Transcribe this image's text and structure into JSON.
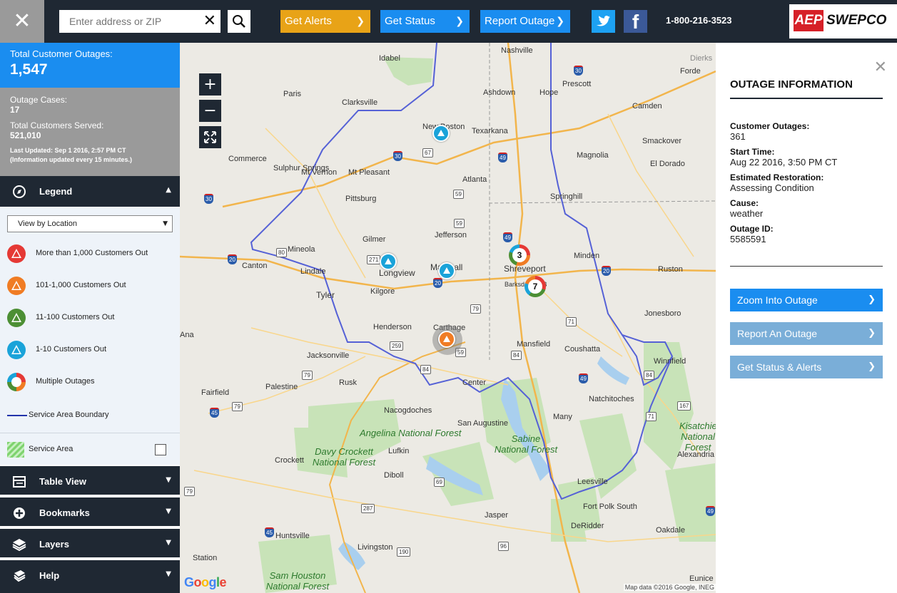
{
  "header": {
    "search_placeholder": "Enter address or ZIP",
    "get_alerts": "Get Alerts",
    "get_status": "Get Status",
    "report_outage": "Report Outage",
    "phone": "1-800-216-3523",
    "logo_aep": "AEP",
    "logo_brand": "SWEPCO"
  },
  "summary": {
    "total_label": "Total Customer Outages:",
    "total_value": "1,547",
    "cases_label": "Outage Cases:",
    "cases_value": "17",
    "served_label": "Total Customers Served:",
    "served_value": "521,010",
    "updated": "Last Updated: Sep 1 2016, 2:57 PM CT",
    "update_note": "(Information updated every 15 minutes.)"
  },
  "legend": {
    "title": "Legend",
    "view_select": "View by Location",
    "items": [
      {
        "label": "More than 1,000 Customers Out",
        "color": "#e53935"
      },
      {
        "label": "101-1,000 Customers Out",
        "color": "#f07c24"
      },
      {
        "label": "11-100 Customers Out",
        "color": "#4c8f34"
      },
      {
        "label": "1-10 Customers Out",
        "color": "#1aa3d9"
      },
      {
        "label": "Multiple Outages",
        "color": "#1aa3d9"
      },
      {
        "label": "Service Area Boundary",
        "color": "#2233aa"
      }
    ],
    "service_area": "Service Area"
  },
  "sections": {
    "table_view": "Table View",
    "bookmarks": "Bookmarks",
    "layers": "Layers",
    "help": "Help"
  },
  "map": {
    "zoom_in": "+",
    "zoom_out": "−",
    "cluster_shreveport": "3",
    "cluster_barksdale": "7",
    "google": "Google",
    "attribution": "Map data ©2016 Google, INEG",
    "cities": [
      "Idabel",
      "Nashville",
      "Hope",
      "Ashdown",
      "Prescott",
      "Paris",
      "Clarksville",
      "New Boston",
      "Texarkana",
      "Camden",
      "Smackover",
      "Magnolia",
      "El Dorado",
      "Commerce",
      "Sulphur Springs",
      "Mt Vernon",
      "Mt Pleasant",
      "Atlanta",
      "Springhill",
      "Pittsburg",
      "Gilmer",
      "Jefferson",
      "Minden",
      "Ruston",
      "Canton",
      "Mineola",
      "Longview",
      "Marshall",
      "Shreveport",
      "Lindale",
      "Kilgore",
      "Tyler",
      "Barksdale AFB",
      "Jonesboro",
      "Henderson",
      "Carthage",
      "Mansfield",
      "Coushatta",
      "Winnfield",
      "Jacksonville",
      "Palestine",
      "Rusk",
      "Center",
      "Natchitoches",
      "Fairfield",
      "Nacogdoches",
      "San Augustine",
      "Many",
      "Alexandria",
      "Lufkin",
      "Crockett",
      "Diboll",
      "Leesville",
      "Fort Polk South",
      "Jasper",
      "DeRidder",
      "Oakdale",
      "Huntsville",
      "Livingston",
      "Station",
      "Eunice",
      "Forde",
      "Dierks",
      "Ana"
    ],
    "parks": [
      "Angelina National Forest",
      "Davy Crockett National Forest",
      "Sabine National Forest",
      "Sam Houston National Forest",
      "Kisatchie National Forest"
    ]
  },
  "outage_info": {
    "title": "OUTAGE INFORMATION",
    "fields": [
      {
        "k": "Customer Outages:",
        "v": "361"
      },
      {
        "k": "Start Time:",
        "v": "Aug 22 2016, 3:50 PM CT"
      },
      {
        "k": "Estimated Restoration:",
        "v": "Assessing Condition"
      },
      {
        "k": "Cause:",
        "v": "weather"
      },
      {
        "k": "Outage ID:",
        "v": "5585591"
      }
    ],
    "zoom_btn": "Zoom Into Outage",
    "report_btn": "Report An Outage",
    "status_btn": "Get Status & Alerts"
  }
}
